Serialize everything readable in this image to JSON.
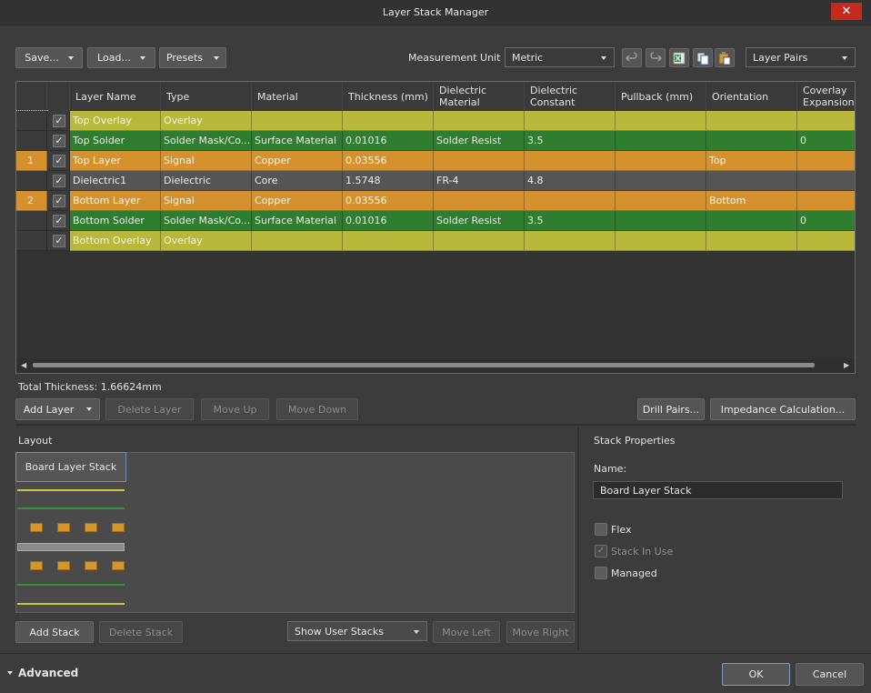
{
  "window": {
    "title": "Layer Stack Manager",
    "close_glyph": "✕"
  },
  "toolbar": {
    "save_label": "Save...",
    "load_label": "Load...",
    "presets_label": "Presets",
    "measurement_unit_label": "Measurement Unit",
    "measurement_unit_value": "Metric",
    "layer_pairs_value": "Layer Pairs",
    "icons": [
      "undo-icon",
      "redo-icon",
      "export-excel-icon",
      "copy-icon",
      "paste-icon"
    ]
  },
  "grid": {
    "columns": [
      "",
      "",
      "Layer Name",
      "Type",
      "Material",
      "Thickness (mm)",
      "Dielectric Material",
      "Dielectric Constant",
      "Pullback (mm)",
      "Orientation",
      "Coverlay Expansion"
    ],
    "rows": [
      {
        "num": "",
        "checked": "✓",
        "name": "Top Overlay",
        "type": "Overlay",
        "material": "",
        "thickness": "",
        "diel_material": "",
        "diel_constant": "",
        "pullback": "",
        "orientation": "",
        "coverlay": "",
        "kind": "overlay"
      },
      {
        "num": "",
        "checked": "✓",
        "name": "Top Solder",
        "type": "Solder Mask/Co...",
        "material": "Surface Material",
        "thickness": "0.01016",
        "diel_material": "Solder Resist",
        "diel_constant": "3.5",
        "pullback": "",
        "orientation": "",
        "coverlay": "0",
        "kind": "solder"
      },
      {
        "num": "1",
        "checked": "✓",
        "name": "Top Layer",
        "type": "Signal",
        "material": "Copper",
        "thickness": "0.03556",
        "diel_material": "",
        "diel_constant": "",
        "pullback": "",
        "orientation": "Top",
        "coverlay": "",
        "kind": "signal"
      },
      {
        "num": "",
        "checked": "✓",
        "name": "Dielectric1",
        "type": "Dielectric",
        "material": "Core",
        "thickness": "1.5748",
        "diel_material": "FR-4",
        "diel_constant": "4.8",
        "pullback": "",
        "orientation": "",
        "coverlay": "",
        "kind": "dielectric"
      },
      {
        "num": "2",
        "checked": "✓",
        "name": "Bottom Layer",
        "type": "Signal",
        "material": "Copper",
        "thickness": "0.03556",
        "diel_material": "",
        "diel_constant": "",
        "pullback": "",
        "orientation": "Bottom",
        "coverlay": "",
        "kind": "signal"
      },
      {
        "num": "",
        "checked": "✓",
        "name": "Bottom Solder",
        "type": "Solder Mask/Co...",
        "material": "Surface Material",
        "thickness": "0.01016",
        "diel_material": "Solder Resist",
        "diel_constant": "3.5",
        "pullback": "",
        "orientation": "",
        "coverlay": "0",
        "kind": "solder"
      },
      {
        "num": "",
        "checked": "✓",
        "name": "Bottom Overlay",
        "type": "Overlay",
        "material": "",
        "thickness": "",
        "diel_material": "",
        "diel_constant": "",
        "pullback": "",
        "orientation": "",
        "coverlay": "",
        "kind": "overlay"
      }
    ],
    "row_colors": {
      "overlay": "#b8b83a",
      "solder": "#2f7d2f",
      "signal": "#d4912e",
      "dielectric": "#555555"
    }
  },
  "total_thickness": "Total Thickness: 1.66624mm",
  "layer_buttons": {
    "add_layer": "Add Layer",
    "delete_layer": "Delete Layer",
    "move_up": "Move Up",
    "move_down": "Move Down",
    "drill_pairs": "Drill Pairs...",
    "impedance": "Impedance Calculation..."
  },
  "layout": {
    "label": "Layout",
    "stack_tab": "Board Layer Stack",
    "add_stack": "Add Stack",
    "delete_stack": "Delete Stack",
    "show_stacks": "Show User Stacks",
    "move_left": "Move Left",
    "move_right": "Move Right"
  },
  "stack_properties": {
    "title": "Stack Properties",
    "name_label": "Name:",
    "name_value": "Board Layer Stack",
    "flex_label": "Flex",
    "stack_in_use_label": "Stack In Use",
    "stack_in_use_check": "✓",
    "managed_label": "Managed"
  },
  "footer": {
    "advanced_label": "Advanced",
    "ok_label": "OK",
    "cancel_label": "Cancel"
  }
}
